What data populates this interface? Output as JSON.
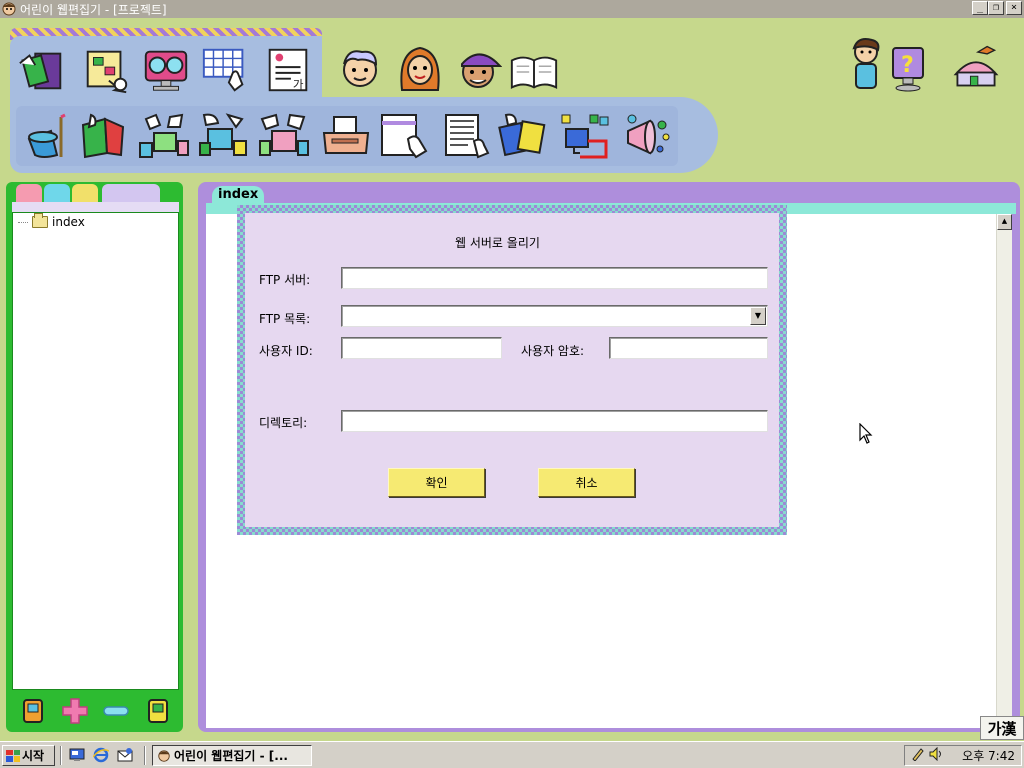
{
  "window": {
    "title": "어린이 웹편집기 - [프로젝트]",
    "minimize_label": "_",
    "restore_label": "❐",
    "close_label": "×"
  },
  "toolbar_top": {
    "items": [
      "project-folder-icon",
      "page-map-icon",
      "monitor-glasses-icon",
      "grid-table-icon",
      "text-document-icon"
    ]
  },
  "characters": [
    "boy-face-icon",
    "girl-face-icon",
    "cap-boy-face-icon",
    "open-book-icon"
  ],
  "right_icons": [
    "thinking-boy-icon",
    "help-monitor-icon",
    "home-village-icon"
  ],
  "toolbar_main": {
    "items": [
      "magic-hat-icon",
      "red-book-icon",
      "computer-sheets-icon",
      "computer-copy-icon",
      "computer-share-icon",
      "printer-icon",
      "new-page-icon",
      "notepad-icon",
      "color-cards-icon",
      "monitor-link-icon",
      "megaphone-icon"
    ]
  },
  "left_panel": {
    "tab_colors": [
      "#f59bb0",
      "#6fd7ea",
      "#f1e06a",
      "#d3c6f0"
    ],
    "tree": [
      {
        "label": "index"
      }
    ],
    "bottom_icons": [
      "save-disk-icon",
      "add-plus-icon",
      "remove-minus-icon",
      "save-as-disk-icon"
    ]
  },
  "document": {
    "tab_label": "index"
  },
  "dialog": {
    "title": "웹 서버로 올리기",
    "ftp_server_label": "FTP 서버:",
    "ftp_server_value": "",
    "ftp_list_label": "FTP 목록:",
    "ftp_list_value": "",
    "user_id_label": "사용자 ID:",
    "user_id_value": "",
    "password_label": "사용자 암호:",
    "password_value": "",
    "directory_label": "디렉토리:",
    "directory_value": "",
    "ok_label": "확인",
    "cancel_label": "취소"
  },
  "ime": {
    "label": "가漢"
  },
  "taskbar": {
    "start_label": "시작",
    "task_label": "어린이 웹편집기 - [...",
    "clock": "오후 7:42"
  },
  "colors": {
    "background": "#c6d88c",
    "toolbar": "#a7bde0",
    "left_panel": "#2dbb31",
    "doc_panel": "#ae8edc",
    "dialog": "#e6d8f0",
    "dialog_button": "#f6ea72"
  }
}
